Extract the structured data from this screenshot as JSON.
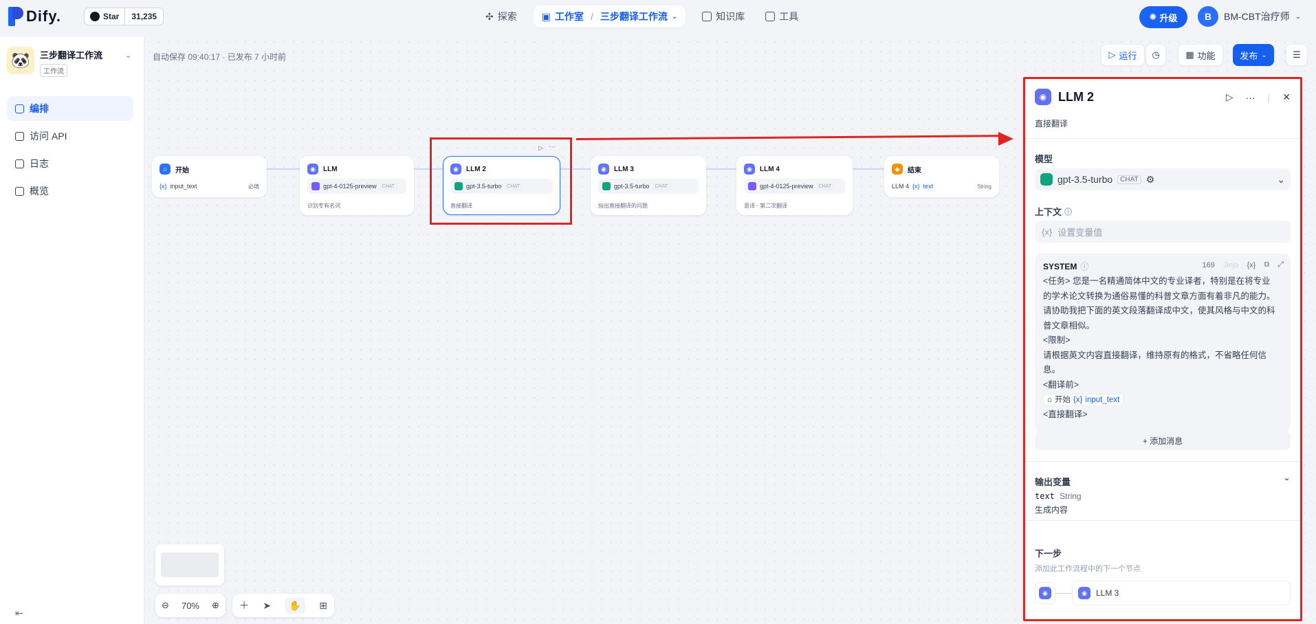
{
  "header": {
    "logo_text": "Dify.",
    "github": {
      "star_label": "Star",
      "count": "31,235"
    },
    "nav": [
      {
        "label": "探索"
      },
      {
        "label": "工作室",
        "current_app": "三步翻译工作流"
      },
      {
        "label": "知识库"
      },
      {
        "label": "工具"
      }
    ],
    "upgrade_label": "升级",
    "user": {
      "initial": "B",
      "name": "BM-CBT治疗师"
    }
  },
  "sidebar": {
    "app_name": "三步翻译工作流",
    "app_type": "工作流",
    "menu": [
      {
        "label": "编排",
        "active": true
      },
      {
        "label": "访问 API"
      },
      {
        "label": "日志"
      },
      {
        "label": "概览"
      }
    ]
  },
  "toolbar": {
    "autosave": "自动保存 09:40:17 · 已发布 7 小时前",
    "run_label": "运行",
    "features_label": "功能",
    "publish_label": "发布"
  },
  "nodes": {
    "start": {
      "title": "开始",
      "var": "input_text",
      "required": "必填"
    },
    "llm1": {
      "title": "LLM",
      "model": "gpt-4-0125-preview",
      "tag": "CHAT",
      "desc": "识别专有名词"
    },
    "llm2": {
      "title": "LLM 2",
      "model": "gpt-3.5-turbo",
      "tag": "CHAT",
      "desc": "直接翻译"
    },
    "llm3": {
      "title": "LLM 3",
      "model": "gpt-3.5-turbo",
      "tag": "CHAT",
      "desc": "指出直接翻译的问题"
    },
    "llm4": {
      "title": "LLM 4",
      "model": "gpt-4-0125-preview",
      "tag": "CHAT",
      "desc": "意译 - 第二次翻译"
    },
    "end": {
      "title": "结束",
      "source": "LLM 4",
      "var": "text",
      "type": "String"
    }
  },
  "zoom": {
    "level": "70%"
  },
  "panel": {
    "title": "LLM 2",
    "desc": "直接翻译",
    "model_label": "模型",
    "model": {
      "name": "gpt-3.5-turbo",
      "tag": "CHAT"
    },
    "context_label": "上下文",
    "context_placeholder": "设置变量值",
    "system": {
      "label": "SYSTEM",
      "count": "169",
      "jinja": "Jinja",
      "lines": [
        "<任务> 您是一名精通简体中文的专业译者，特别是在将专业",
        "的学术论文转换为通俗易懂的科普文章方面有着非凡的能力。",
        "请协助我把下面的英文段落翻译成中文，使其风格与中文的科",
        "普文章相似。",
        "<限制>",
        "请根据英文内容直接翻译，维持原有的格式，不省略任何信",
        "息。",
        "<翻译前>"
      ],
      "var_node": "开始",
      "var_name": "input_text",
      "last_line": "<直接翻译>"
    },
    "add_message": "+ 添加消息",
    "output_label": "输出变量",
    "output": {
      "name": "text",
      "type": "String",
      "desc": "生成内容"
    },
    "next_label": "下一步",
    "next_desc": "添加此工作流程中的下一个节点",
    "next_node": "LLM 3"
  }
}
